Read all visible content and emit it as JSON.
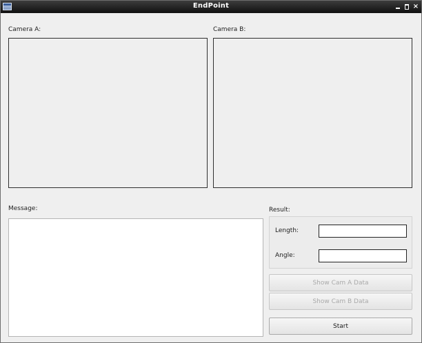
{
  "window": {
    "title": "EndPoint"
  },
  "window_controls": {
    "close_glyph": "×"
  },
  "camera_a": {
    "label": "Camera A:"
  },
  "camera_b": {
    "label": "Camera B:"
  },
  "message": {
    "label": "Message:",
    "value": ""
  },
  "result": {
    "label": "Result:",
    "length_label": "Length:",
    "length_value": "",
    "angle_label": "Angle:",
    "angle_value": ""
  },
  "buttons": {
    "show_cam_a": "Show Cam A Data",
    "show_cam_b": "Show Cam B Data",
    "start": "Start"
  }
}
